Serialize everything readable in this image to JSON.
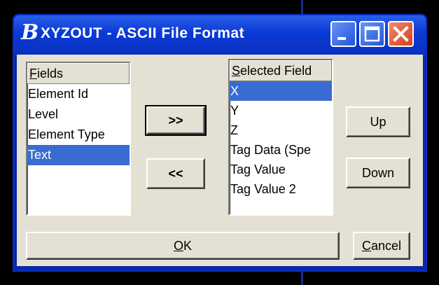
{
  "window": {
    "title": "XYZOUT - ASCII File Format",
    "app_icon": "B",
    "controls": {
      "minimize": "minimize-icon",
      "maximize": "maximize-icon",
      "close": "close-icon"
    }
  },
  "fields_list": {
    "header_accel": "F",
    "header_rest": "ields",
    "items": [
      "Element Id",
      "Level",
      "Element Type",
      "Text"
    ],
    "selected": "Text"
  },
  "selected_list": {
    "header_accel": "S",
    "header_rest": "elected Field",
    "items": [
      "X",
      "Y",
      "Z",
      "Tag Data (Spe",
      "Tag Value",
      "Tag Value 2"
    ],
    "selected": "X"
  },
  "buttons": {
    "add": ">>",
    "remove": "<<",
    "up": "Up",
    "down": "Down",
    "ok_accel": "O",
    "ok_rest": "K",
    "cancel_accel": "C",
    "cancel_rest": "ancel"
  },
  "colors": {
    "title_bar": "#0a3ad6",
    "selection": "#3a6bd1",
    "dialog_face": "#e4e1d4",
    "close_button": "#d2401e"
  }
}
